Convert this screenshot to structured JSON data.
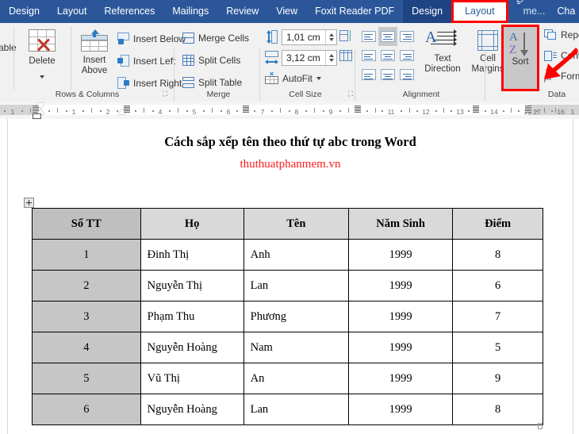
{
  "tabstrip": {
    "tabs": [
      {
        "label": "Design",
        "state": "normal"
      },
      {
        "label": "Layout",
        "state": "normal"
      },
      {
        "label": "References",
        "state": "normal"
      },
      {
        "label": "Mailings",
        "state": "normal"
      },
      {
        "label": "Review",
        "state": "normal"
      },
      {
        "label": "View",
        "state": "normal"
      },
      {
        "label": "Foxit Reader PDF",
        "state": "normal"
      },
      {
        "label": "Design",
        "state": "contextual"
      },
      {
        "label": "Layout",
        "state": "active"
      }
    ],
    "tell_me": "Tell me...",
    "share": "Cha",
    "active_highlight_color": "#ff0000",
    "bar_color": "#2b579a"
  },
  "ribbon": {
    "groups": [
      {
        "name": "Rows & Columns",
        "label": "Rows & Columns",
        "items": [
          {
            "label": "able",
            "icon": "partial-table-label"
          },
          {
            "label": "Delete",
            "icon": "delete-table-icon",
            "has_dropdown": true
          },
          {
            "label": "Insert Above",
            "icon": "insert-above-icon"
          },
          {
            "label": "Insert Below",
            "icon": "insert-below-icon"
          },
          {
            "label": "Insert Left",
            "icon": "insert-left-icon"
          },
          {
            "label": "Insert Right",
            "icon": "insert-right-icon"
          }
        ]
      },
      {
        "name": "Merge",
        "label": "Merge",
        "items": [
          {
            "label": "Merge Cells",
            "icon": "merge-cells-icon"
          },
          {
            "label": "Split Cells",
            "icon": "split-cells-icon"
          },
          {
            "label": "Split Table",
            "icon": "split-table-icon"
          }
        ]
      },
      {
        "name": "Cell Size",
        "label": "Cell Size",
        "items": [
          {
            "label": "AutoFit",
            "icon": "autofit-icon",
            "has_dropdown": true
          }
        ],
        "fields": [
          {
            "name": "row-height",
            "value": "1,01 cm",
            "icon": "table-row-height-icon"
          },
          {
            "name": "column-width",
            "value": "3,12 cm",
            "icon": "table-column-width-icon"
          }
        ],
        "distribute": [
          {
            "name": "distribute-rows-icon"
          },
          {
            "name": "distribute-columns-icon"
          }
        ]
      },
      {
        "name": "Alignment",
        "label": "Alignment",
        "items": [
          {
            "label": "Text Direction",
            "icon": "text-direction-icon"
          },
          {
            "label": "Cell Margins",
            "icon": "cell-margins-icon"
          }
        ],
        "align_selected_index": 1
      },
      {
        "name": "Data",
        "label": "Data",
        "items": [
          {
            "label": "Sort",
            "icon": "sort-az-icon",
            "highlighted": true
          },
          {
            "label": "Repeat",
            "icon": "repeat-header-rows-icon"
          },
          {
            "label": "Conve",
            "icon": "convert-to-text-icon"
          },
          {
            "label": "Formu",
            "icon": "formula-icon"
          }
        ]
      }
    ]
  },
  "ruler": {
    "unit_labels": [
      "1",
      "1",
      "2",
      "4",
      "5",
      "6",
      "7",
      "8",
      "9",
      "11",
      "12",
      "13",
      "14",
      "15",
      "16",
      "17",
      "1"
    ]
  },
  "document": {
    "title": "Cách sắp xếp tên theo thứ tự abc trong Word",
    "subtitle": "thuthuatphanmem.vn",
    "subtitle_color": "#ff1a1a",
    "table": {
      "headers": [
        "Số TT",
        "Họ",
        "Tên",
        "Năm Sinh",
        "Điểm"
      ],
      "rows": [
        [
          "1",
          "Đinh Thị",
          "Anh",
          "1999",
          "8"
        ],
        [
          "2",
          "Nguyễn Thị",
          "Lan",
          "1999",
          "6"
        ],
        [
          "3",
          "Phạm Thu",
          "Phương",
          "1999",
          "7"
        ],
        [
          "4",
          "Nguyễn Hoàng",
          "Nam",
          "1999",
          "5"
        ],
        [
          "5",
          "Vũ Thị",
          "An",
          "1999",
          "9"
        ],
        [
          "6",
          "Nguyễn Hoàng",
          "Lan",
          "1999",
          "8"
        ]
      ]
    }
  }
}
